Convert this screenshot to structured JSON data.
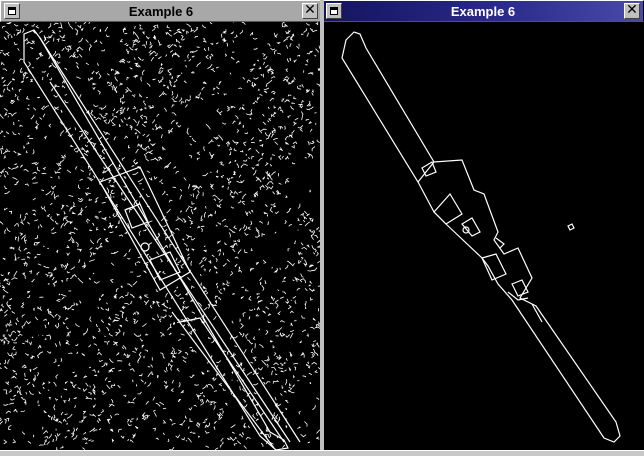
{
  "left_window": {
    "title": "Example 6",
    "state": "inactive",
    "icons": {
      "menu": "window-menu-icon",
      "close": "close-icon"
    },
    "close_glyph": "✕"
  },
  "right_window": {
    "title": "Example 6",
    "state": "active",
    "icons": {
      "menu": "window-menu-icon",
      "close": "close-icon"
    },
    "close_glyph": "✕"
  },
  "content": {
    "left": "noisy edge-detection output of a knife on textured background",
    "right": "clean edge-detection output of a knife on black background"
  },
  "colors": {
    "active_title_start": "#14145e",
    "active_title_end": "#4a4aa8",
    "inactive_title": "#a8a8a8",
    "canvas_bg": "#000000",
    "edge_color": "#ffffff"
  }
}
